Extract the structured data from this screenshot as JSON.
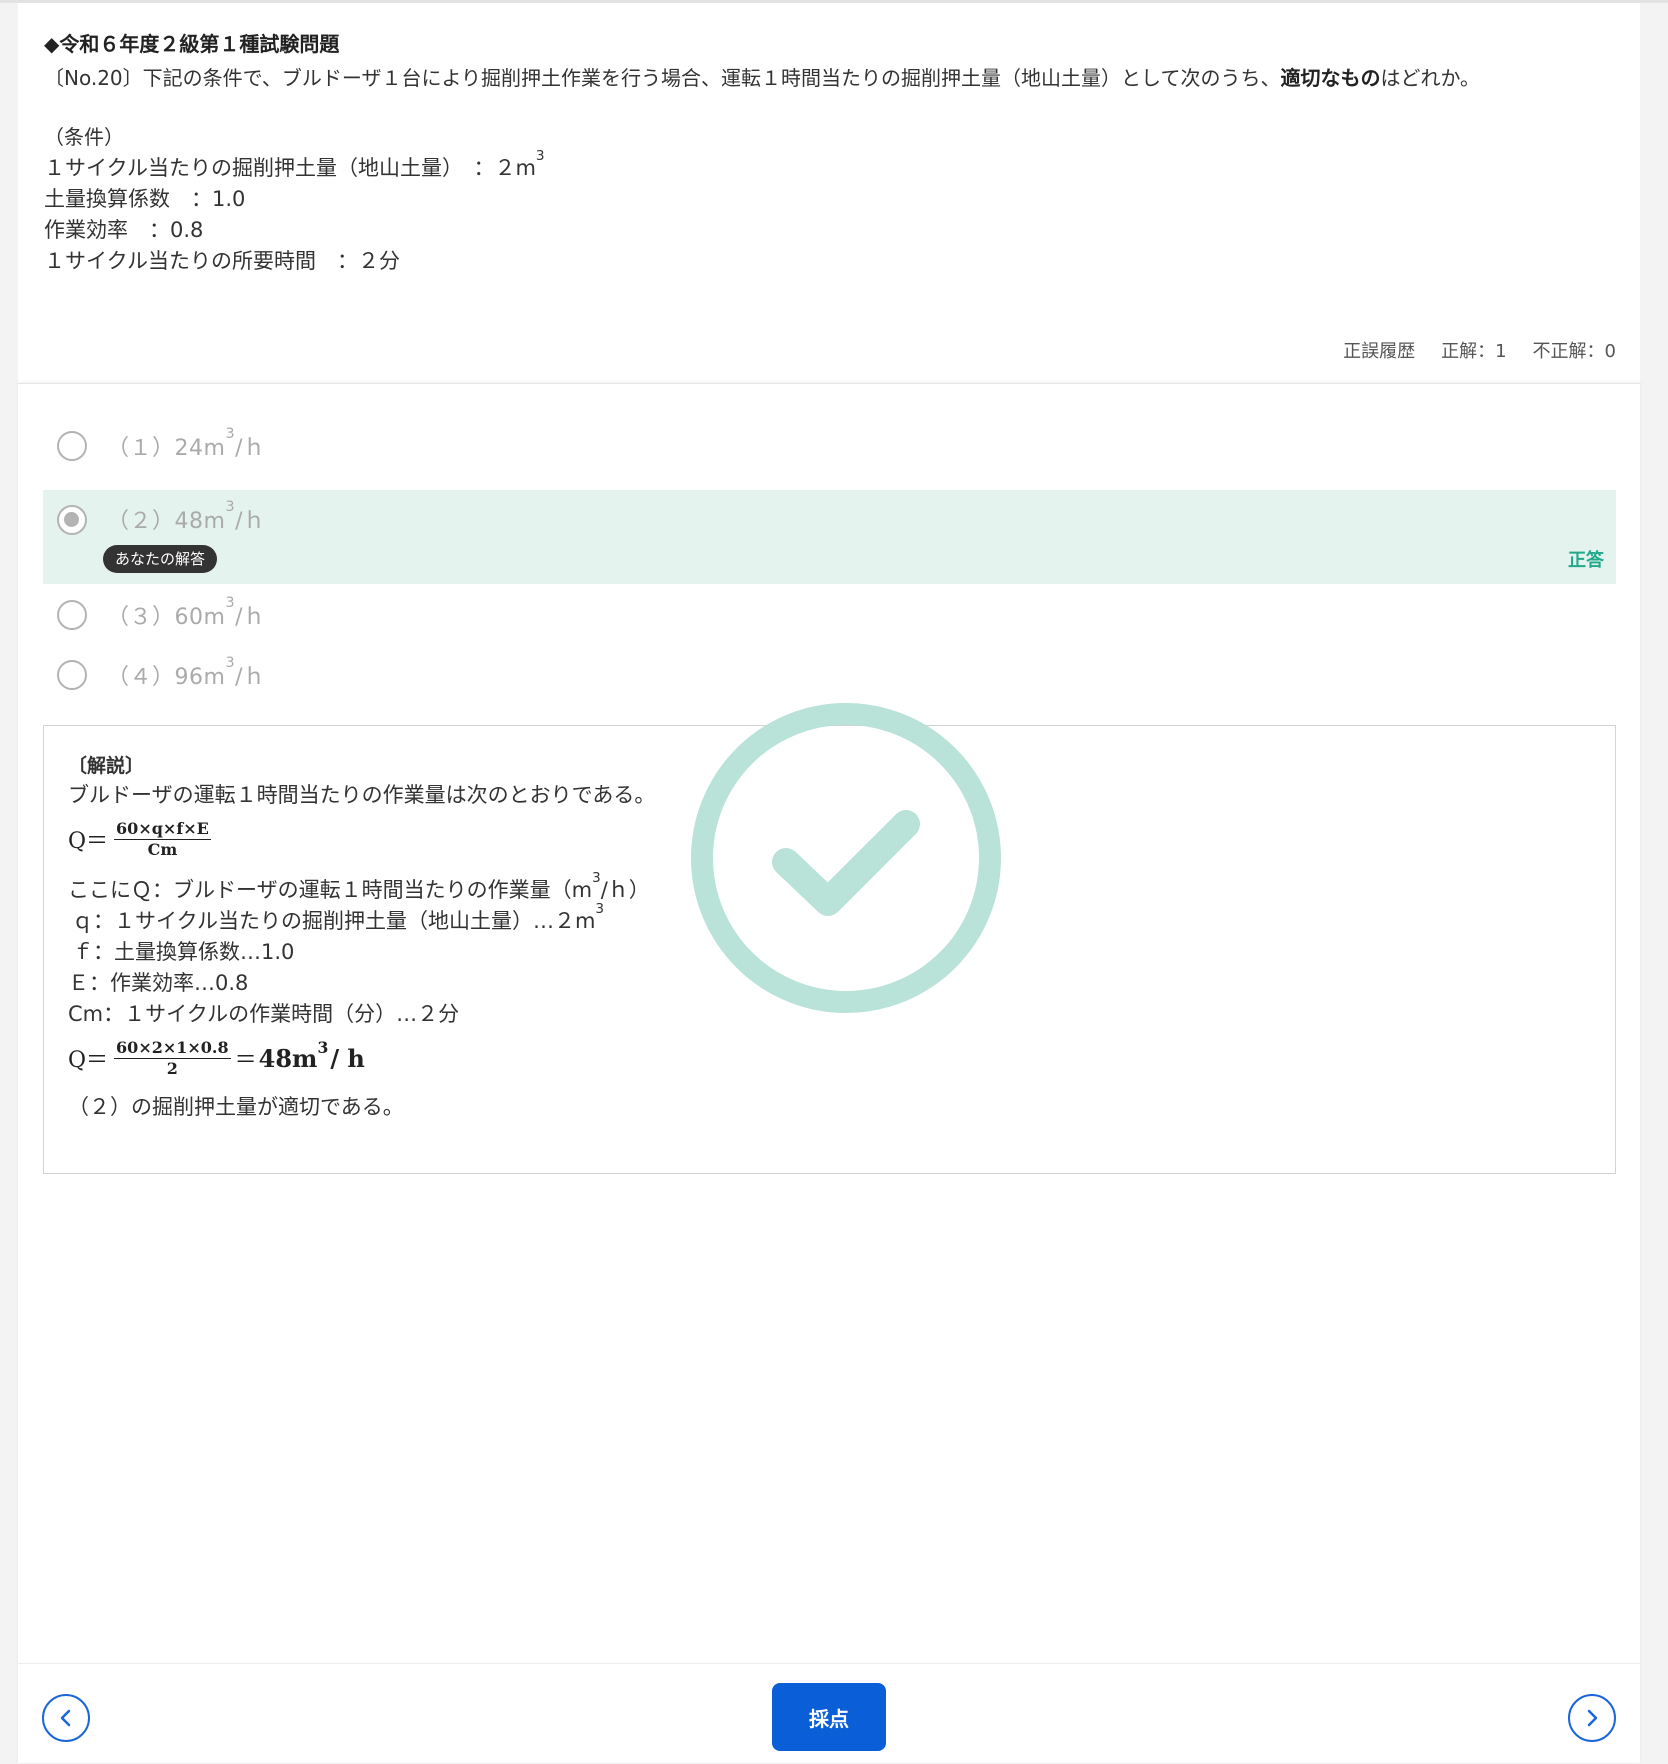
{
  "question": {
    "title": "◆令和６年度２級第１種試験問題",
    "text_before_bold": "〔No.20〕下記の条件で、ブルドーザ１台により掘削押土作業を行う場合、運転１時間当たりの掘削押土量（地山土量）として次のうち、",
    "text_bold": "適切なもの",
    "text_after_bold": "はどれか。",
    "conditions_heading": "（条件）",
    "conditions": {
      "c1_label": "１サイクル当たりの掘削押土量（地山土量）　：２m",
      "c1_sup": "3",
      "c2": "土量換算係数　：1.0",
      "c3": "作業効率　：0.8",
      "c4": "１サイクル当たりの所要時間　：２分"
    }
  },
  "history": {
    "label": "正誤履歴",
    "correct": "正解：1",
    "incorrect": "不正解：0"
  },
  "options": [
    {
      "num": "（１）",
      "value": "24m",
      "sup": "3",
      "unit": "/ｈ"
    },
    {
      "num": "（２）",
      "value": "48m",
      "sup": "3",
      "unit": "/ｈ"
    },
    {
      "num": "（３）",
      "value": "60m",
      "sup": "3",
      "unit": "/ｈ"
    },
    {
      "num": "（４）",
      "value": "96m",
      "sup": "3",
      "unit": "/ｈ"
    }
  ],
  "selected": {
    "badge": "あなたの解答",
    "result": "正答"
  },
  "explanation": {
    "heading": "〔解説〕",
    "intro": "ブルドーザの運転１時間当たりの作業量は次のとおりである。",
    "formula1": {
      "lhs": "Q＝",
      "num": "60×q×f×E",
      "den": "Cm"
    },
    "def_q_pre": "ここにＱ：ブルドーザの運転１時間当たりの作業量（m",
    "def_q_sup": "3",
    "def_q_post": "/ｈ）",
    "def_sq_pre": "ｑ：１サイクル当たりの掘削押土量（地山土量）…２m",
    "def_sq_sup": "3",
    "def_f": "ｆ：土量換算係数…1.0",
    "def_e": "Ｅ：作業効率…0.8",
    "def_cm": "Cm：１サイクルの作業時間（分）…２分",
    "formula2": {
      "lhs": "Q＝",
      "num": "60×2×1×0.8",
      "den": "2",
      "eq": "＝",
      "res": "48m",
      "res_sup": "3",
      "res_unit": "/ h"
    },
    "conclusion": "（２）の掘削押土量が適切である。"
  },
  "footer": {
    "submit_label": "採点",
    "prev_icon": "chevron-left-icon",
    "next_icon": "chevron-right-icon"
  },
  "colors": {
    "accent": "#0a5fd8",
    "correct": "#22a88a",
    "selected_bg": "#e5f3ef",
    "stamp": "#b9e2d8"
  }
}
